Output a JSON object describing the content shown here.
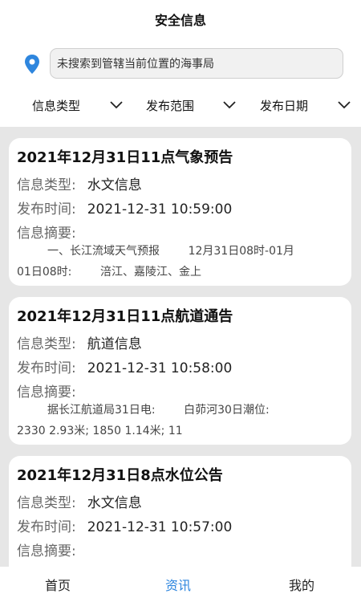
{
  "header": {
    "title": "安全信息"
  },
  "search": {
    "text": "未搜索到管辖当前位置的海事局"
  },
  "filters": [
    {
      "label": "信息类型"
    },
    {
      "label": "发布范围"
    },
    {
      "label": "发布日期"
    }
  ],
  "cards": [
    {
      "title": "2021年12月31日11点气象预告",
      "type_key": "信息类型:",
      "type_val": "水文信息",
      "time_key": "发布时间:",
      "time_val": "2021-12-31 10:59:00",
      "summary_key": "信息摘要:",
      "summary_line1": "一、长江流域天气预报        12月31日08时-01月",
      "summary_line2": "01日08时:        涪江、嘉陵江、金上"
    },
    {
      "title": "2021年12月31日11点航道通告",
      "type_key": "信息类型:",
      "type_val": "航道信息",
      "time_key": "发布时间:",
      "time_val": "2021-12-31 10:58:00",
      "summary_key": "信息摘要:",
      "summary_line1": "据长江航道局31日电:        白茆河30日潮位:",
      "summary_line2": "2330 2.93米; 1850 1.14米; 11"
    },
    {
      "title": "2021年12月31日8点水位公告",
      "type_key": "信息类型:",
      "type_val": "水文信息",
      "time_key": "发布时间:",
      "time_val": "2021-12-31 10:57:00",
      "summary_key": "信息摘要:"
    }
  ],
  "tabbar": {
    "home": "首页",
    "news": "资讯",
    "mine": "我的"
  },
  "colors": {
    "accent": "#2e86de",
    "list_bg": "#e6e6e6"
  }
}
